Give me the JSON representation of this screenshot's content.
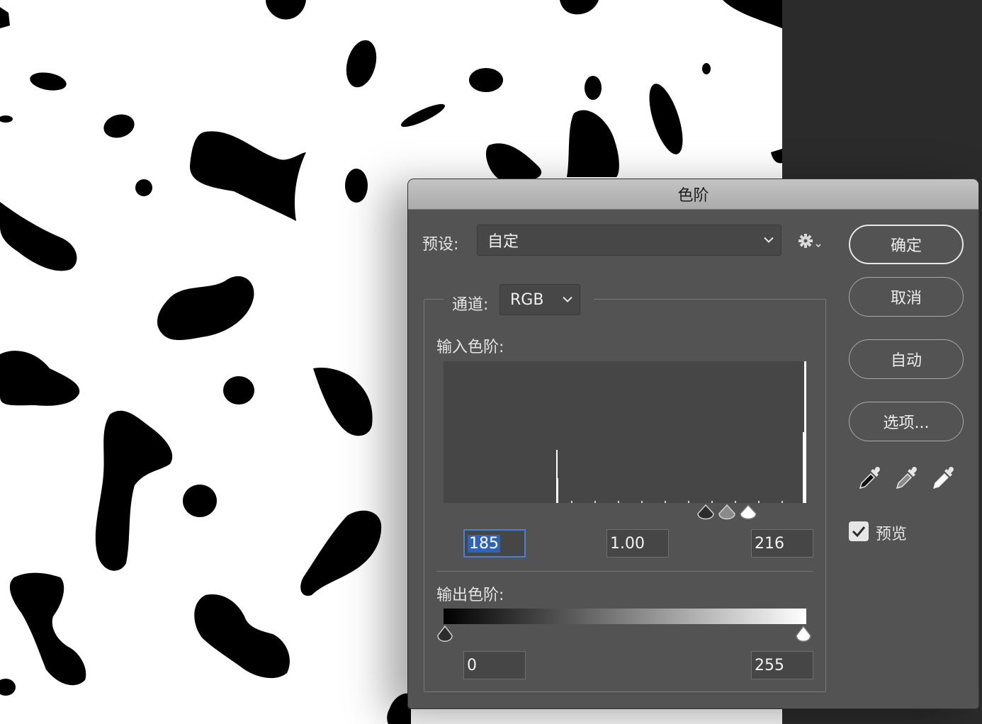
{
  "dialog": {
    "title": "色阶",
    "preset_label": "预设:",
    "preset_value": "自定",
    "channel_label": "通道:",
    "channel_value": "RGB",
    "input_levels_label": "输入色阶:",
    "input_black": "185",
    "input_gamma": "1.00",
    "input_white": "216",
    "output_levels_label": "输出色阶:",
    "output_black": "0",
    "output_white": "255",
    "buttons": {
      "ok": "确定",
      "cancel": "取消",
      "auto": "自动",
      "options": "选项..."
    },
    "preview_label": "预览",
    "preview_checked": true
  },
  "icons": [
    "chevron-down-icon",
    "gear-icon",
    "black-eyedropper-icon",
    "gray-eyedropper-icon",
    "white-eyedropper-icon",
    "checkmark-icon"
  ],
  "colors": {
    "dialog_bg": "#535353",
    "titlebar": "#b8b8b8",
    "field_bg": "#464646",
    "focus_ring": "#4a7fd6",
    "canvas_bg": "#ffffff",
    "blobs": "#000000"
  }
}
